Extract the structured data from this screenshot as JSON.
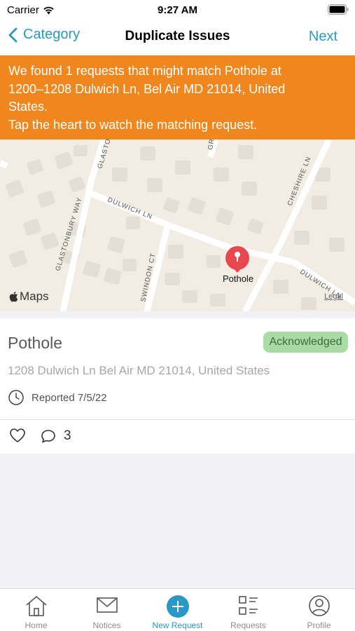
{
  "status_bar": {
    "carrier": "Carrier",
    "time": "9:27 AM"
  },
  "nav": {
    "back_label": "Category",
    "title": "Duplicate Issues",
    "next_label": "Next"
  },
  "banner": {
    "line1": "We found 1 requests that might match Pothole at",
    "line2": "1200–1208 Dulwich Ln, Bel Air MD 21014, United",
    "line3": "States.",
    "line4": "Tap the heart to watch the matching request."
  },
  "map": {
    "streets": [
      "DULWICH LN",
      "GLASTONBURY WAY",
      "GLASTO",
      "SWINDON CT",
      "CHESHIRE LN",
      "DULWICH LN",
      "GR"
    ],
    "pin_label": "Pothole",
    "maps_brand": "Maps",
    "legal": "Legal"
  },
  "request": {
    "title": "Pothole",
    "status": "Acknowledged",
    "address": "1208 Dulwich Ln Bel Air MD 21014, United States",
    "reported": "Reported 7/5/22",
    "comment_count": "3"
  },
  "tabs": [
    {
      "label": "Home",
      "icon": "home-icon"
    },
    {
      "label": "Notices",
      "icon": "envelope-icon"
    },
    {
      "label": "New Request",
      "icon": "plus-circle-icon"
    },
    {
      "label": "Requests",
      "icon": "list-icon"
    },
    {
      "label": "Profile",
      "icon": "person-icon"
    }
  ],
  "colors": {
    "accent": "#2a98c5",
    "banner": "#f0861e",
    "badge_bg": "#a9dba5",
    "pin": "#e8474f"
  }
}
